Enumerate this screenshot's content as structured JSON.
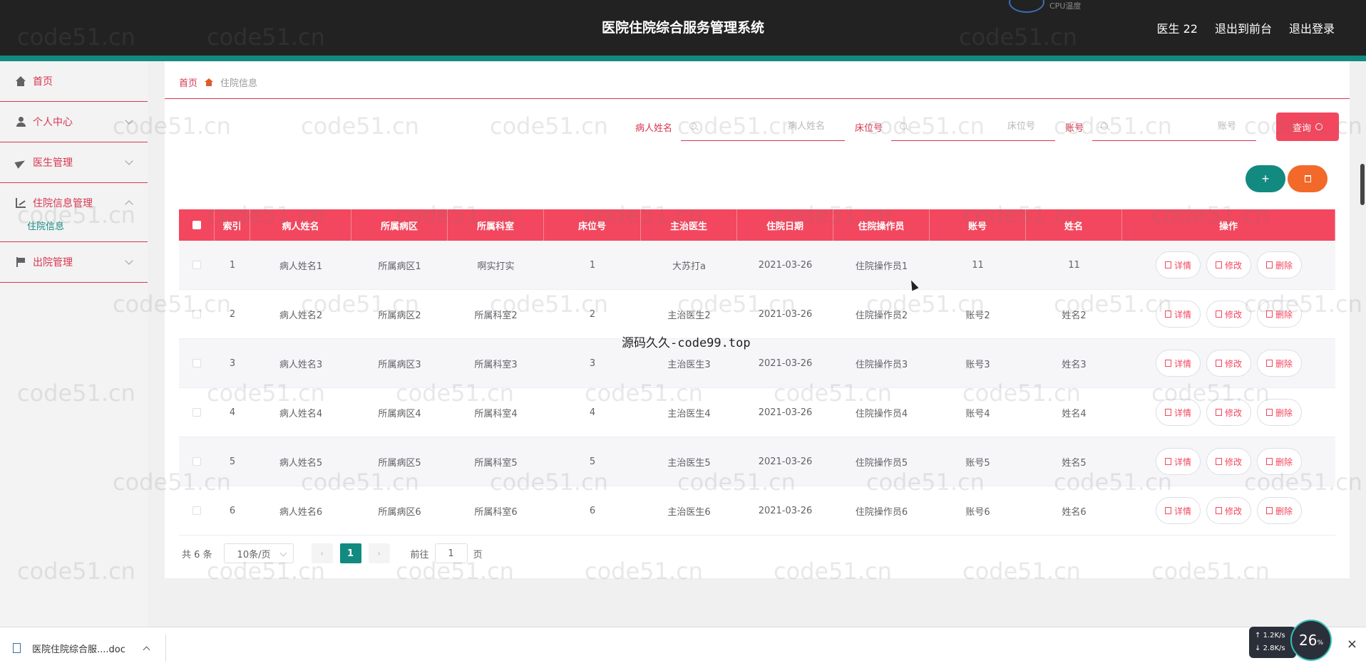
{
  "header": {
    "title": "医院住院综合服务管理系统",
    "user": "医生 22",
    "to_front": "退出到前台",
    "logout": "退出登录",
    "cpu_label": "CPU温度"
  },
  "sidebar": {
    "items": [
      {
        "label": "首页",
        "icon": "home-icon"
      },
      {
        "label": "个人中心",
        "icon": "user-icon"
      },
      {
        "label": "医生管理",
        "icon": "send-icon"
      },
      {
        "label": "住院信息管理",
        "icon": "chart-icon",
        "sub": "住院信息"
      },
      {
        "label": "出院管理",
        "icon": "flag-icon"
      }
    ]
  },
  "breadcrumb": {
    "home": "首页",
    "current": "住院信息"
  },
  "search": {
    "patient_label": "病人姓名",
    "patient_placeholder": "病人姓名",
    "bed_label": "床位号",
    "bed_placeholder": "床位号",
    "account_label": "账号",
    "account_placeholder": "账号",
    "query_label": "查询"
  },
  "actions": {
    "add": "+"
  },
  "table": {
    "headers": [
      "索引",
      "病人姓名",
      "所属病区",
      "所属科室",
      "床位号",
      "主治医生",
      "住院日期",
      "住院操作员",
      "账号",
      "姓名",
      "操作"
    ],
    "rows": [
      [
        "1",
        "病人姓名1",
        "所属病区1",
        "啊实打实",
        "1",
        "大苏打a",
        "2021-03-26",
        "住院操作员1",
        "11",
        "11"
      ],
      [
        "2",
        "病人姓名2",
        "所属病区2",
        "所属科室2",
        "2",
        "主治医生2",
        "2021-03-26",
        "住院操作员2",
        "账号2",
        "姓名2"
      ],
      [
        "3",
        "病人姓名3",
        "所属病区3",
        "所属科室3",
        "3",
        "主治医生3",
        "2021-03-26",
        "住院操作员3",
        "账号3",
        "姓名3"
      ],
      [
        "4",
        "病人姓名4",
        "所属病区4",
        "所属科室4",
        "4",
        "主治医生4",
        "2021-03-26",
        "住院操作员4",
        "账号4",
        "姓名4"
      ],
      [
        "5",
        "病人姓名5",
        "所属病区5",
        "所属科室5",
        "5",
        "主治医生5",
        "2021-03-26",
        "住院操作员5",
        "账号5",
        "姓名5"
      ],
      [
        "6",
        "病人姓名6",
        "所属病区6",
        "所属科室6",
        "6",
        "主治医生6",
        "2021-03-26",
        "住院操作员6",
        "账号6",
        "姓名6"
      ]
    ],
    "row_actions": {
      "detail": "详情",
      "edit": "修改",
      "delete": "删除"
    }
  },
  "pagination": {
    "total": "共 6 条",
    "page_size": "10条/页",
    "current_page": "1",
    "goto_label": "前往",
    "goto_value": "1",
    "page_suffix": "页",
    "prev": "‹",
    "next": "›"
  },
  "watermark": {
    "text": "code51.cn",
    "center": "源码久久-code99.top"
  },
  "download_bar": {
    "file": "医院住院综合服....doc",
    "net_up": "1.2",
    "net_down": "2.8",
    "net_unit": "K/s",
    "cpu_percent": "26",
    "percent_sign": "%",
    "close": "×"
  }
}
